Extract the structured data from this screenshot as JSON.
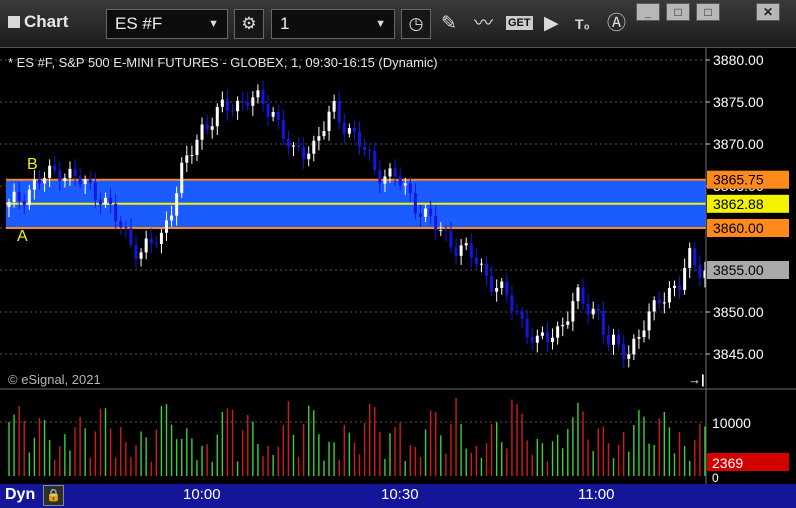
{
  "window": {
    "title": "Chart",
    "controls": [
      "_",
      "□",
      "□",
      "✕"
    ]
  },
  "toolbar": {
    "symbol_value": "ES #F",
    "interval_value": "1",
    "study_button_label": "GET",
    "icons": [
      "settings-gear-icon",
      "clock-icon",
      "pencil-icon",
      "line-study-icon",
      "get-study-icon",
      "play-icon",
      "text-tool-icon",
      "alert-icon"
    ]
  },
  "chart": {
    "header": "* ES #F, S&P 500 E-MINI FUTURES - GLOBEX, 1, 09:30-16:15 (Dynamic)",
    "copyright": "© eSignal, 2021",
    "scroll_icon": "→|",
    "markers": {
      "a_label": "A",
      "b_label": "B"
    },
    "price_axis_labels": [
      "3880.00",
      "3875.00",
      "3870.00",
      "3865.00",
      "3850.00",
      "3845.00"
    ],
    "price_markers": [
      {
        "text": "3865.75",
        "value": 3865.75,
        "color": "#ff8a1c"
      },
      {
        "text": "3862.88",
        "value": 3862.88,
        "color": "#f3f300"
      },
      {
        "text": "3860.00",
        "value": 3860.0,
        "color": "#ff8a1c"
      },
      {
        "text": "3855.00",
        "value": 3855.0,
        "color": "#a9a9a9"
      }
    ],
    "zone": {
      "high": 3865.75,
      "low": 3860.0,
      "mid": 3862.88,
      "fill": "#1a5cff",
      "edge": "#ff8a1c",
      "mid_line": "#f3f300"
    },
    "colors": {
      "up": "#ffffff",
      "down": "#1515e0",
      "vol_up": "#3bd13b",
      "vol_down": "#d21a1a",
      "grid": "#555555"
    }
  },
  "volume": {
    "axis_labels": [
      "10000",
      "0"
    ],
    "last_label": "2369",
    "last_color": "#d40000"
  },
  "time_axis": [
    "10:00",
    "10:30",
    "11:00"
  ],
  "statusbar": {
    "mode": "Dyn"
  }
}
